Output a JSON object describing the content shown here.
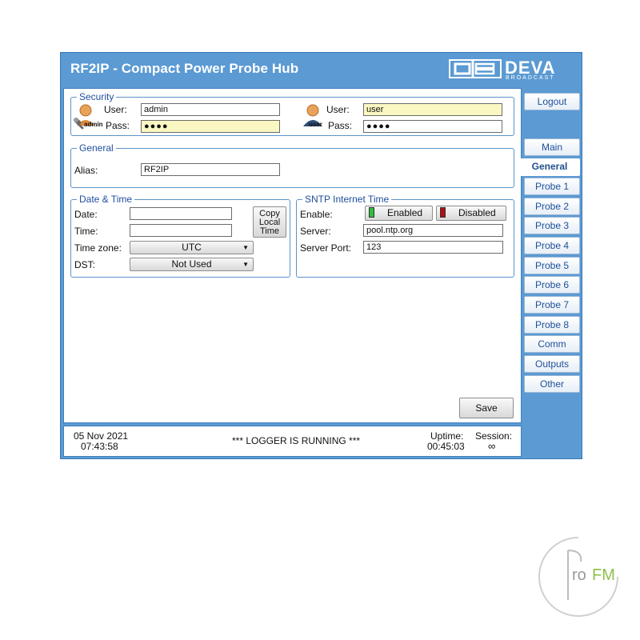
{
  "window": {
    "title": "RF2IP - Compact Power Probe Hub"
  },
  "logo": {
    "brand": "DEVA",
    "sub": "BROADCAST"
  },
  "security": {
    "legend": "Security",
    "admin": {
      "user_label": "User:",
      "user_value": "admin",
      "pass_label": "Pass:",
      "pass_value": "●●●●",
      "badge": "admin"
    },
    "user": {
      "user_label": "User:",
      "user_value": "user",
      "pass_label": "Pass:",
      "pass_value": "●●●●",
      "badge": "user"
    }
  },
  "general": {
    "legend": "General",
    "alias_label": "Alias:",
    "alias_value": "RF2IP"
  },
  "datetime": {
    "legend": "Date & Time",
    "date_label": "Date:",
    "date_value": "",
    "time_label": "Time:",
    "time_value": "",
    "timezone_label": "Time zone:",
    "timezone_value": "UTC",
    "dst_label": "DST:",
    "dst_value": "Not Used",
    "copy_line1": "Copy",
    "copy_line2": "Local",
    "copy_line3": "Time"
  },
  "sntp": {
    "legend": "SNTP Internet Time",
    "enable_label": "Enable:",
    "enabled_label": "Enabled",
    "disabled_label": "Disabled",
    "server_label": "Server:",
    "server_value": "pool.ntp.org",
    "port_label": "Server Port:",
    "port_value": "123"
  },
  "save_label": "Save",
  "sidebar": {
    "logout": "Logout",
    "tabs": [
      "Main",
      "General",
      "Probe 1",
      "Probe 2",
      "Probe 3",
      "Probe 4",
      "Probe 5",
      "Probe 6",
      "Probe 7",
      "Probe 8",
      "Comm",
      "Outputs",
      "Other"
    ],
    "active": "General"
  },
  "status": {
    "date": "05 Nov 2021",
    "time": "07:43:58",
    "message": "*** LOGGER IS RUNNING ***",
    "uptime_label": "Uptime:",
    "uptime_value": "00:45:03",
    "session_label": "Session:",
    "session_value": "∞"
  },
  "watermark": {
    "text_r": "ro",
    "text_fm": "FM"
  },
  "colors": {
    "frame": "#5b9ad3",
    "accent": "#1f4e9e",
    "led_on": "#2fbf3a",
    "led_off": "#b01010",
    "watermark": "#8fbf4a"
  }
}
